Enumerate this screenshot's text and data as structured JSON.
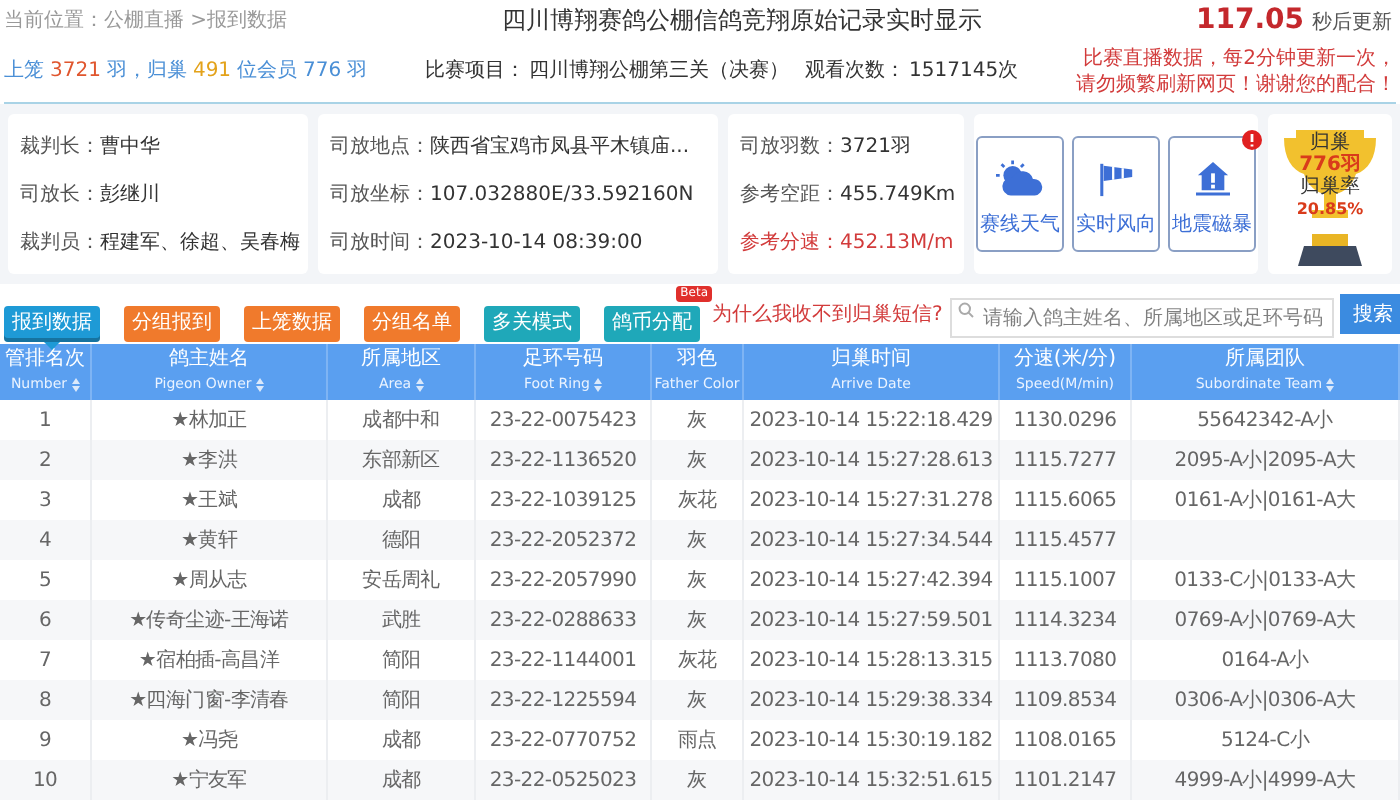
{
  "breadcrumb": "当前位置：公棚直播 >报到数据",
  "title": "四川博翔赛鸽公棚信鸽竞翔原始记录实时显示",
  "timer": {
    "value": "117.05",
    "label": "秒后更新"
  },
  "stats": [
    {
      "text": "上笼",
      "color": "#4a8fd6"
    },
    {
      "text": "3721",
      "color": "#e0562e"
    },
    {
      "text": "羽，归巢",
      "color": "#4a8fd6"
    },
    {
      "text": "491",
      "color": "#e3a21a"
    },
    {
      "text": "位会员",
      "color": "#4a8fd6"
    },
    {
      "text": "776",
      "color": "#4a8fd6"
    },
    {
      "text": "羽",
      "color": "#4a8fd6"
    }
  ],
  "race": {
    "label": "比赛项目：",
    "value": "四川博翔公棚第三关（决赛）",
    "views_label": "观看次数：",
    "views": "1517145次"
  },
  "notice": [
    "比赛直播数据，每2分钟更新一次，",
    "请勿频繁刷新网页！谢谢您的配合！"
  ],
  "info_cards": [
    [
      {
        "label": "裁判长：",
        "value": "曹中华",
        "emphasis": false
      },
      {
        "label": "司放长：",
        "value": "彭继川",
        "emphasis": false
      },
      {
        "label": "裁判员：",
        "value": "程建军、徐超、吴春梅",
        "emphasis": false
      }
    ],
    [
      {
        "label": "司放地点：",
        "value": "陕西省宝鸡市凤县平木镇庙...",
        "emphasis": false
      },
      {
        "label": "司放坐标：",
        "value": "107.032880E/33.592160N",
        "emphasis": false
      },
      {
        "label": "司放时间：",
        "value": "2023-10-14 08:39:00",
        "emphasis": false
      }
    ],
    [
      {
        "label": "司放羽数：",
        "value": "3721羽",
        "emphasis": false
      },
      {
        "label": "参考空距：",
        "value": "455.749Km",
        "emphasis": false
      },
      {
        "label": "参考分速：",
        "value": "452.13M/m",
        "emphasis": true
      }
    ]
  ],
  "tools": [
    {
      "label": "赛线天气",
      "kind": "weather",
      "alert": false
    },
    {
      "label": "实时风向",
      "kind": "wind",
      "alert": false
    },
    {
      "label": "地震磁暴",
      "kind": "quake",
      "alert": true
    }
  ],
  "trophy": {
    "label": "归巢",
    "count": "776羽",
    "rate_label": "归巢率",
    "rate": "20.85%"
  },
  "tabs": [
    {
      "label": "报到数据",
      "selected": true,
      "color": "#1e9ad6"
    },
    {
      "label": "分组报到",
      "selected": false,
      "color": "#f07a2c"
    },
    {
      "label": "上笼数据",
      "selected": false,
      "color": "#f07a2c"
    },
    {
      "label": "分组名单",
      "selected": false,
      "color": "#f07a2c"
    },
    {
      "label": "多关模式",
      "selected": false,
      "color": "#1fa8b9"
    },
    {
      "label": "鸽币分配",
      "selected": false,
      "color": "#1fa8b9",
      "badge": "Beta"
    }
  ],
  "sms_link": "为什么我收不到归巢短信?",
  "search": {
    "placeholder": "请输入鸽主姓名、所属地区或足环号码",
    "button": "搜索"
  },
  "table": {
    "columns": [
      {
        "cn": "管排名次",
        "en": "Number",
        "sortable": true
      },
      {
        "cn": "鸽主姓名",
        "en": "Pigeon Owner",
        "sortable": true
      },
      {
        "cn": "所属地区",
        "en": "Area",
        "sortable": true
      },
      {
        "cn": "足环号码",
        "en": "Foot Ring",
        "sortable": true
      },
      {
        "cn": "羽色",
        "en": "Father Color",
        "sortable": false
      },
      {
        "cn": "归巢时间",
        "en": "Arrive Date",
        "sortable": false
      },
      {
        "cn": "分速(米/分)",
        "en": "Speed(M/min)",
        "sortable": false
      },
      {
        "cn": "所属团队",
        "en": "Subordinate Team",
        "sortable": true
      }
    ],
    "rows": [
      [
        "1",
        "★林加正",
        "成都中和",
        "23-22-0075423",
        "灰",
        "2023-10-14 15:22:18.429",
        "1130.0296",
        "55642342-A小"
      ],
      [
        "2",
        "★李洪",
        "东部新区",
        "23-22-1136520",
        "灰",
        "2023-10-14 15:27:28.613",
        "1115.7277",
        "2095-A小|2095-A大"
      ],
      [
        "3",
        "★王斌",
        "成都",
        "23-22-1039125",
        "灰花",
        "2023-10-14 15:27:31.278",
        "1115.6065",
        "0161-A小|0161-A大"
      ],
      [
        "4",
        "★黄轩",
        "德阳",
        "23-22-2052372",
        "灰",
        "2023-10-14 15:27:34.544",
        "1115.4577",
        ""
      ],
      [
        "5",
        "★周从志",
        "安岳周礼",
        "23-22-2057990",
        "灰",
        "2023-10-14 15:27:42.394",
        "1115.1007",
        "0133-C小|0133-A大"
      ],
      [
        "6",
        "★传奇尘迹-王海诺",
        "武胜",
        "23-22-0288633",
        "灰",
        "2023-10-14 15:27:59.501",
        "1114.3234",
        "0769-A小|0769-A大"
      ],
      [
        "7",
        "★宿柏插-高昌洋",
        "简阳",
        "23-22-1144001",
        "灰花",
        "2023-10-14 15:28:13.315",
        "1113.7080",
        "0164-A小"
      ],
      [
        "8",
        "★四海门窗-李清春",
        "简阳",
        "23-22-1225594",
        "灰",
        "2023-10-14 15:29:38.334",
        "1109.8534",
        "0306-A小|0306-A大"
      ],
      [
        "9",
        "★冯尧",
        "成都",
        "23-22-0770752",
        "雨点",
        "2023-10-14 15:30:19.182",
        "1108.0165",
        "5124-C小"
      ],
      [
        "10",
        "★宁友军",
        "成都",
        "23-22-0525023",
        "灰",
        "2023-10-14 15:32:51.615",
        "1101.2147",
        "4999-A小|4999-A大"
      ]
    ]
  }
}
